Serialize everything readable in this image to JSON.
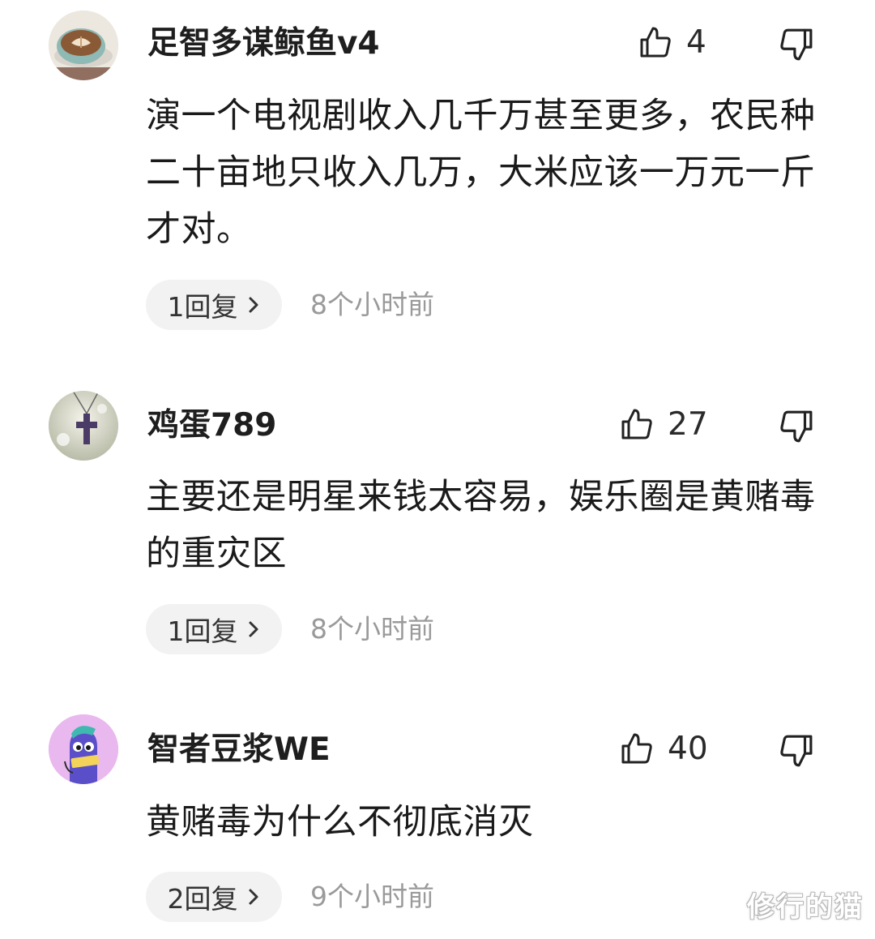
{
  "comments": [
    {
      "username": "足智多谋鲸鱼v4",
      "avatar": "coffee-cup-avatar",
      "likes": "4",
      "text": "演一个电视剧收入几千万甚至更多，农民种二十亩地只收入几万，大米应该一万元一斤才对。",
      "replies": "1回复",
      "time": "8个小时前"
    },
    {
      "username": "鸡蛋789",
      "avatar": "cross-pendant-avatar",
      "likes": "27",
      "text": "主要还是明星来钱太容易，娱乐圈是黄赌毒的重灾区",
      "replies": "1回复",
      "time": "8个小时前"
    },
    {
      "username": "智者豆浆WE",
      "avatar": "cartoon-character-avatar",
      "likes": "40",
      "text": "黄赌毒为什么不彻底消灭",
      "replies": "2回复",
      "time": "9个小时前"
    }
  ],
  "watermark": "修行的猫",
  "icons": {
    "like": "thumbs-up-icon",
    "dislike": "thumbs-down-icon",
    "chevron": "chevron-right-icon"
  },
  "colors": {
    "text": "#1a1a1a",
    "time": "#9a9a9a",
    "reply_bg": "#f2f2f2"
  }
}
